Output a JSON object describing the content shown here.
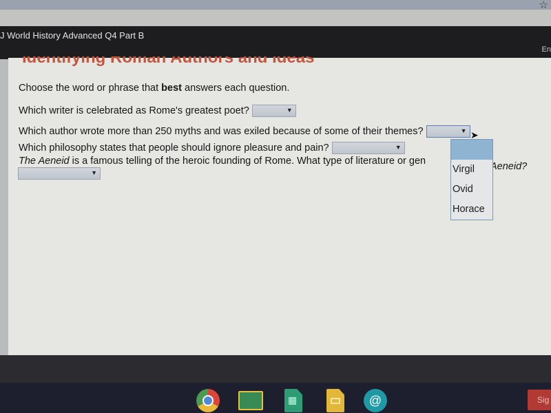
{
  "browser": {
    "bookmark_icon": "star-icon"
  },
  "header": {
    "title": "J World History Advanced Q4 Part B",
    "right_text": "En"
  },
  "lesson": {
    "title": "Identifying Roman Authors and Ideas",
    "instructions_pre": "Choose the word or phrase that ",
    "instructions_bold": "best",
    "instructions_post": " answers each question.",
    "questions": [
      {
        "text": "Which writer is celebrated as Rome's greatest poet?",
        "selected": ""
      },
      {
        "text": "Which author wrote more than 250 myths and was exiled because of some of their themes?",
        "selected": ""
      },
      {
        "text": "Which philosophy states that people should ignore pleasure and pain?",
        "selected": ""
      },
      {
        "text_italic": "The Aeneid",
        "text": " is a famous telling of the heroic founding of Rome. What type of literature or gen",
        "text_tail": "Aeneid?",
        "selected": ""
      }
    ]
  },
  "dropdown": {
    "open_for_question": 2,
    "options": [
      "",
      "Virgil",
      "Ovid",
      "Horace"
    ],
    "highlighted": 0
  },
  "shelf": {
    "apps": [
      "chrome-icon",
      "google-classroom-icon",
      "google-sheets-icon",
      "google-slides-icon",
      "hangouts-icon"
    ],
    "signout_label": "Sig"
  }
}
